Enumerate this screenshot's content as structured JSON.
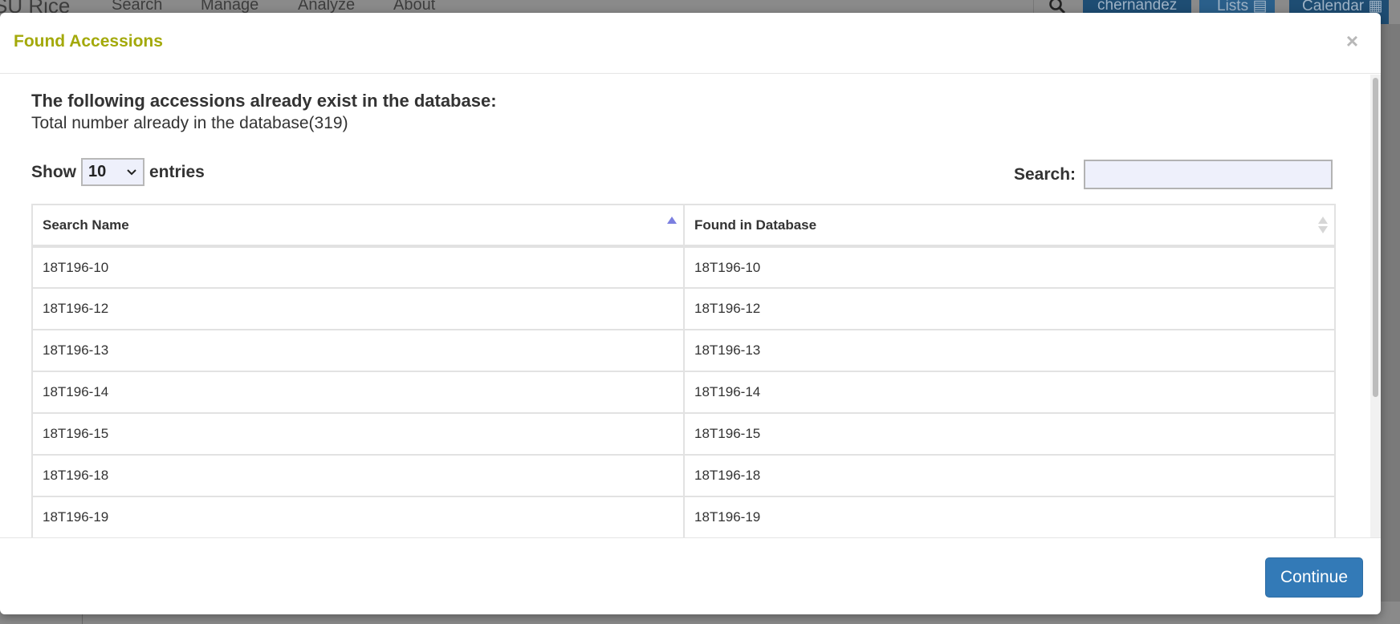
{
  "navbar": {
    "brand": "SU Rice",
    "items": [
      "Search",
      "Manage",
      "Analyze",
      "About"
    ],
    "user": "chernandez",
    "lists_label": "Lists",
    "calendar_label": "Calendar"
  },
  "modal": {
    "title": "Found Accessions",
    "close_symbol": "×",
    "heading": "The following accessions already exist in the database:",
    "total_text": "Total number already in the database(319)",
    "show_label": "Show",
    "entries_label": "entries",
    "page_length": "10",
    "search_label": "Search:",
    "search_value": "",
    "columns": [
      "Search Name",
      "Found in Database"
    ],
    "rows": [
      [
        "18T196-10",
        "18T196-10"
      ],
      [
        "18T196-12",
        "18T196-12"
      ],
      [
        "18T196-13",
        "18T196-13"
      ],
      [
        "18T196-14",
        "18T196-14"
      ],
      [
        "18T196-15",
        "18T196-15"
      ],
      [
        "18T196-18",
        "18T196-18"
      ],
      [
        "18T196-19",
        "18T196-19"
      ]
    ],
    "continue_label": "Continue"
  },
  "colors": {
    "title": "#a3a90a",
    "primary_button": "#337ab7",
    "navbar_accent": "#1e4d73"
  }
}
